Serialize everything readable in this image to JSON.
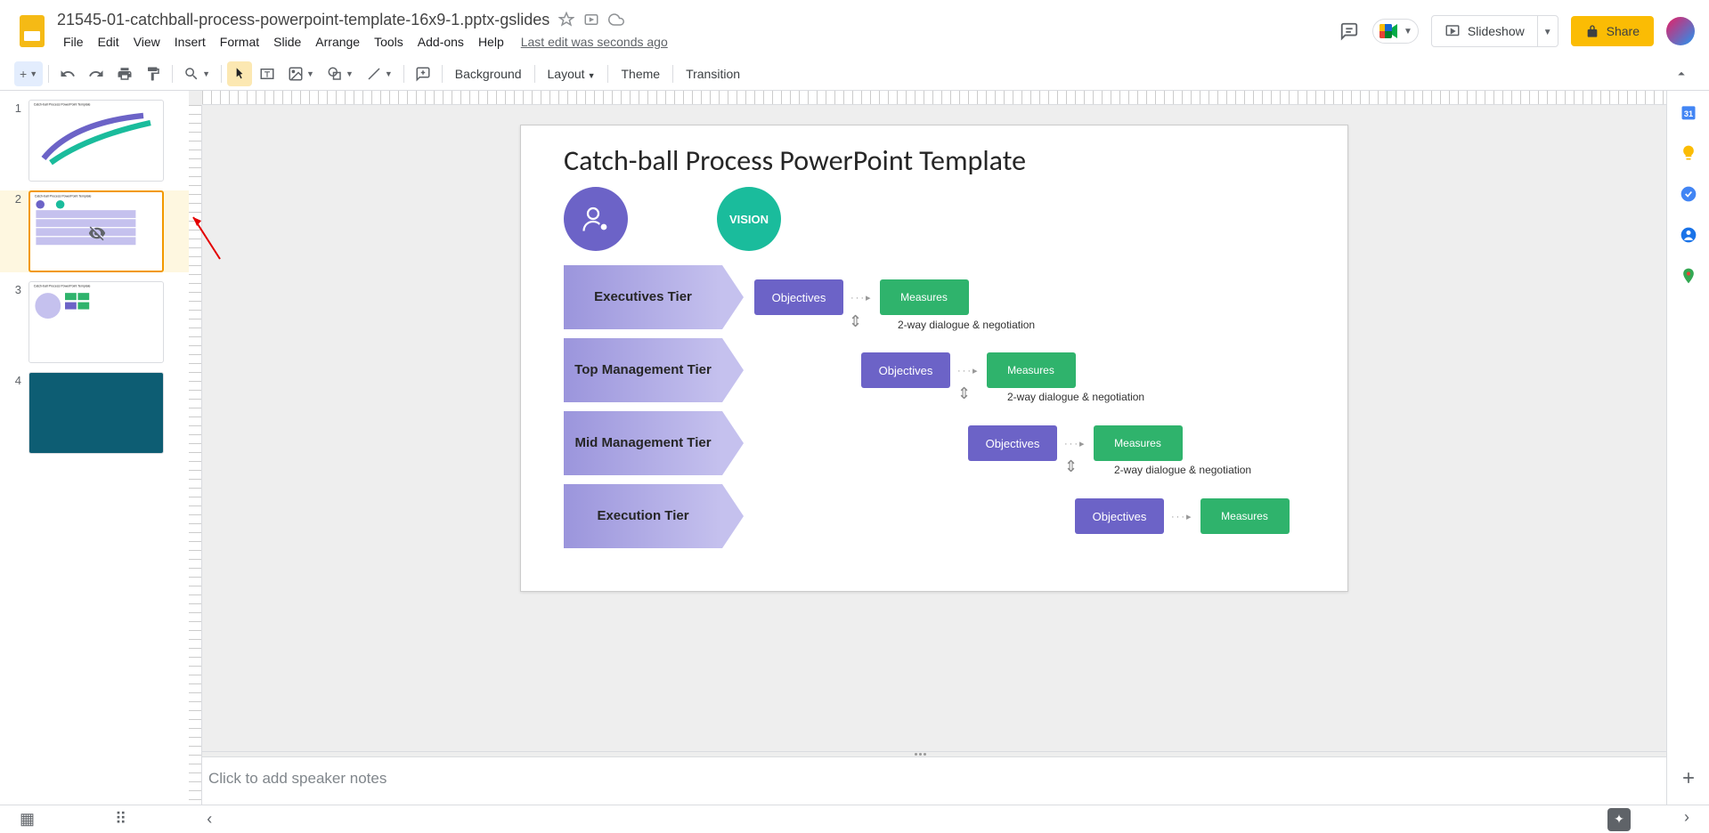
{
  "doc": {
    "title": "21545-01-catchball-process-powerpoint-template-16x9-1.pptx-gslides",
    "last_edit": "Last edit was seconds ago"
  },
  "menu": {
    "file": "File",
    "edit": "Edit",
    "view": "View",
    "insert": "Insert",
    "format": "Format",
    "slide": "Slide",
    "arrange": "Arrange",
    "tools": "Tools",
    "addons": "Add-ons",
    "help": "Help"
  },
  "header_buttons": {
    "slideshow": "Slideshow",
    "share": "Share"
  },
  "toolbar": {
    "background": "Background",
    "layout": "Layout",
    "theme": "Theme",
    "transition": "Transition"
  },
  "filmstrip": {
    "slides": [
      {
        "num": "1",
        "title": "Catch-ball Process PowerPoint Template"
      },
      {
        "num": "2",
        "title": "Catch-ball Process PowerPoint Template"
      },
      {
        "num": "3",
        "title": "Catch-ball Process PowerPoint Template"
      },
      {
        "num": "4",
        "title": ""
      }
    ]
  },
  "slide": {
    "title": "Catch-ball Process PowerPoint Template",
    "vision": "VISION",
    "tiers": [
      {
        "label": "Executives Tier",
        "objectives": "Objectives",
        "measures": "Measures",
        "dialogue": "2-way dialogue & negotiation"
      },
      {
        "label": "Top Management Tier",
        "objectives": "Objectives",
        "measures": "Measures",
        "dialogue": "2-way dialogue & negotiation"
      },
      {
        "label": "Mid Management Tier",
        "objectives": "Objectives",
        "measures": "Measures",
        "dialogue": "2-way dialogue & negotiation"
      },
      {
        "label": "Execution Tier",
        "objectives": "Objectives",
        "measures": "Measures"
      }
    ]
  },
  "notes": {
    "placeholder": "Click to add speaker notes"
  }
}
